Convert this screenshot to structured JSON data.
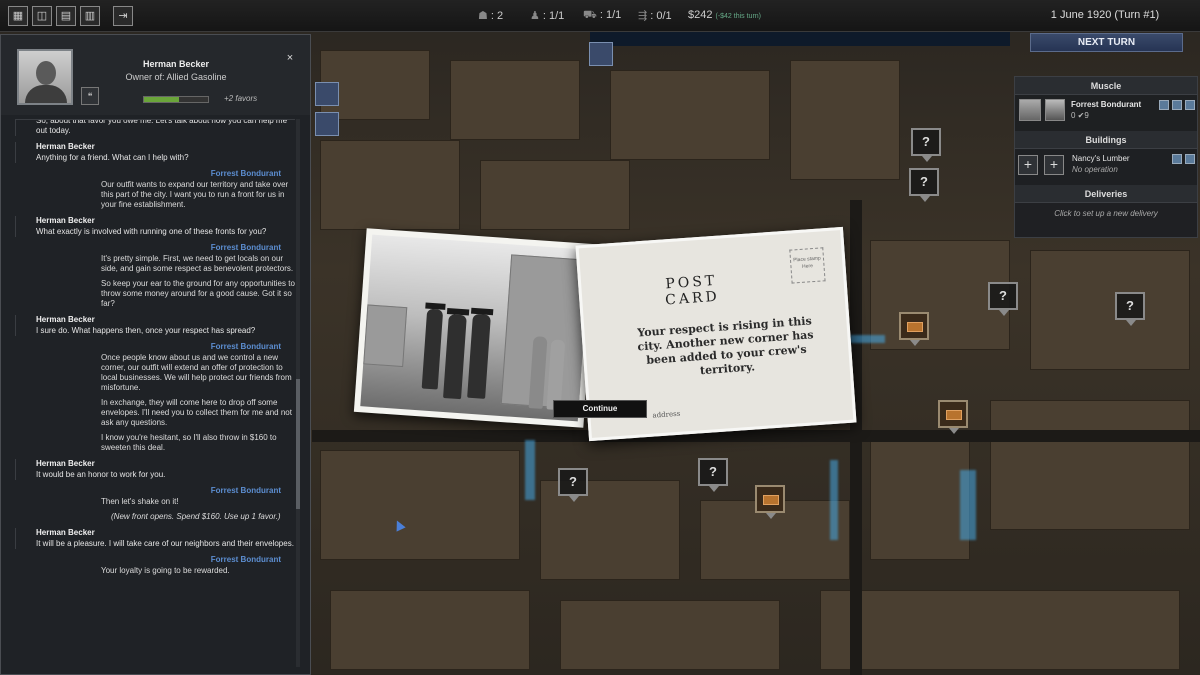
{
  "topbar": {
    "icons": [
      "map-filter-icon",
      "map-overlay-icon",
      "ledger-icon",
      "report-icon",
      "exit-icon"
    ],
    "stats": {
      "crew": "2",
      "muscle": "1/1",
      "vehicles": "1/1",
      "deliveries": "0/1",
      "money": "$242",
      "money_sub": "(-$42 this turn)"
    },
    "date": "1 June 1920 (Turn #1)",
    "next_turn_label": "NEXT TURN"
  },
  "panel": {
    "char_name": "Herman Becker",
    "char_role": "Owner of: Allied Gasoline",
    "favor_fraction": 0.55,
    "favor_text": "+2 favors",
    "close_label": "×",
    "messages": [
      {
        "speaker": "",
        "side": "hb",
        "paras": [
          "So, about that favor you owe me. Let's talk about how you can help me out today."
        ]
      },
      {
        "speaker": "Herman Becker",
        "side": "hb",
        "paras": [
          "Anything for a friend. What can I help with?"
        ]
      },
      {
        "speaker": "Forrest Bondurant",
        "side": "fb",
        "paras": [
          "Our outfit wants to expand our territory and take over this part of the city. I want you to run a front for us in your fine establishment."
        ]
      },
      {
        "speaker": "Herman Becker",
        "side": "hb",
        "paras": [
          "What exactly is involved with running one of these fronts for you?"
        ]
      },
      {
        "speaker": "Forrest Bondurant",
        "side": "fb",
        "paras": [
          "It's pretty simple. First, we need to get locals on our side, and gain some respect as benevolent protectors.",
          "So keep your ear to the ground for any opportunities to throw some money around for a good cause. Got it so far?"
        ]
      },
      {
        "speaker": "Herman Becker",
        "side": "hb",
        "paras": [
          "I sure do. What happens then, once your respect has spread?"
        ]
      },
      {
        "speaker": "Forrest Bondurant",
        "side": "fb",
        "paras": [
          "Once people know about us and we control a new corner, our outfit will extend an offer of protection to local businesses. We will help protect our friends from misfortune.",
          "In exchange, they will come here to drop off some envelopes. I'll need you to collect them for me and not ask any questions.",
          "I know you're hesitant, so I'll also throw in $160 to sweeten this deal."
        ]
      },
      {
        "speaker": "Herman Becker",
        "side": "hb",
        "paras": [
          "It would be an honor to work for you."
        ]
      },
      {
        "speaker": "Forrest Bondurant",
        "side": "fb",
        "paras": [
          "Then let's shake on it!"
        ],
        "system": "(New front opens. Spend $160. Use up 1 favor.)"
      },
      {
        "speaker": "Herman Becker",
        "side": "hb",
        "paras": [
          "It will be a pleasure. I will take care of our neighbors and their envelopes."
        ]
      },
      {
        "speaker": "Forrest Bondurant",
        "side": "fb",
        "paras": [
          "Your loyalty is going to be rewarded."
        ]
      }
    ]
  },
  "side": {
    "muscle_header": "Muscle",
    "muscle_name": "Forrest Bondurant",
    "muscle_stats": "0 ✔9",
    "buildings_header": "Buildings",
    "add_label": "+",
    "building_name": "Nancy's Lumber",
    "building_sub": "No operation",
    "deliveries_header": "Deliveries",
    "deliveries_text": "Click to set up a new delivery"
  },
  "postcard": {
    "title": "POST CARD",
    "stamp": "Place stamp Here",
    "message": "Your respect is rising in this city. Another new corner has been added to your crew's territory.",
    "address": "address",
    "continue_label": "Continue"
  },
  "map": {
    "unknown_marker": "?"
  }
}
